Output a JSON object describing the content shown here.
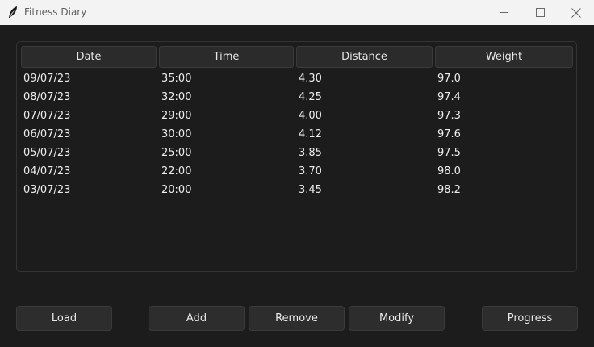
{
  "window": {
    "title": "Fitness Diary",
    "icons": {
      "app": "feather-icon",
      "minimize": "minimize-icon",
      "maximize": "maximize-icon",
      "close": "close-icon"
    }
  },
  "table": {
    "headers": [
      "Date",
      "Time",
      "Distance",
      "Weight"
    ],
    "rows": [
      [
        "09/07/23",
        "35:00",
        "4.30",
        "97.0"
      ],
      [
        "08/07/23",
        "32:00",
        "4.25",
        "97.4"
      ],
      [
        "07/07/23",
        "29:00",
        "4.00",
        "97.3"
      ],
      [
        "06/07/23",
        "30:00",
        "4.12",
        "97.6"
      ],
      [
        "05/07/23",
        "25:00",
        "3.85",
        "97.5"
      ],
      [
        "04/07/23",
        "22:00",
        "3.70",
        "98.0"
      ],
      [
        "03/07/23",
        "20:00",
        "3.45",
        "98.2"
      ]
    ]
  },
  "buttons": {
    "load": "Load",
    "add": "Add",
    "remove": "Remove",
    "modify": "Modify",
    "progress": "Progress"
  },
  "colors": {
    "background": "#1c1c1c",
    "titlebar": "#f3f3f3",
    "header": "#2b2b2b",
    "button": "#2d2d2d"
  }
}
